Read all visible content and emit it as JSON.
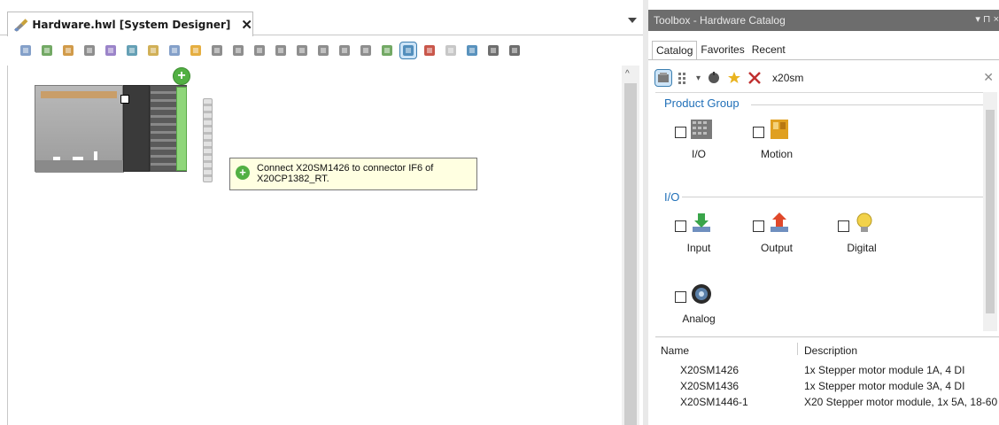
{
  "document": {
    "tab_title": "Hardware.hwl [System Designer]",
    "close_glyph": "✕",
    "dropdown_glyph": "▾",
    "scroll_up_glyph": "^"
  },
  "toolbar": {
    "icons": [
      "open-icon",
      "zoom-icon",
      "module-icon",
      "network-icon",
      "link-icon",
      "refresh-icon",
      "lock-icon",
      "find-icon",
      "highlight-icon",
      "align-left-icon",
      "align-right-icon",
      "align-top-icon",
      "align-bottom-icon",
      "distribute-h-icon",
      "distribute-v-icon",
      "same-width-icon",
      "same-height-icon",
      "grid-connect-icon",
      "text-view-icon",
      "text-icon",
      "grid-icon",
      "fit-icon",
      "zoom-search-icon",
      "settings-icon"
    ],
    "active_icon": "text-view-icon"
  },
  "diagram": {
    "add_glyph": "+",
    "tooltip": "Connect X20SM1426 to connector IF6 of X20CP1382_RT."
  },
  "toolbox": {
    "title": "Toolbox - Hardware Catalog",
    "header_buttons": "▾ ⊓ ×",
    "tabs": [
      {
        "label": "Catalog",
        "active": true
      },
      {
        "label": "Favorites",
        "active": false
      },
      {
        "label": "Recent",
        "active": false
      }
    ],
    "search": {
      "value": "x20sm",
      "clear_glyph": "✕",
      "dropdown_glyph": "▾"
    },
    "sections": [
      {
        "title": "Product Group",
        "items": [
          {
            "label": "I/O",
            "icon": "io-module-icon",
            "color": "#7a7a7a"
          },
          {
            "label": "Motion",
            "icon": "motion-module-icon",
            "color": "#e0a020"
          }
        ]
      },
      {
        "title": "I/O",
        "items": [
          {
            "label": "Input",
            "icon": "input-arrow-icon",
            "color": "#3aa54a"
          },
          {
            "label": "Output",
            "icon": "output-arrow-icon",
            "color": "#e0482a"
          },
          {
            "label": "Digital",
            "icon": "lightbulb-icon",
            "color": "#f2d24a"
          },
          {
            "label": "Analog",
            "icon": "analog-gauge-icon",
            "color": "#2b2b2b"
          }
        ]
      }
    ],
    "results": {
      "columns": [
        "Name",
        "Description"
      ],
      "rows": [
        {
          "name": "X20SM1426",
          "description": "1x Stepper motor module 1A, 4 DI"
        },
        {
          "name": "X20SM1436",
          "description": "1x Stepper motor module 3A, 4 DI"
        },
        {
          "name": "X20SM1446-1",
          "description": "X20 Stepper motor module, 1x 5A, 18-60"
        }
      ]
    }
  },
  "colors": {
    "accent": "#1f6fb8",
    "toolbox_header": "#6d6d6d",
    "tooltip_bg": "#ffffe1",
    "add_green": "#52b043"
  }
}
